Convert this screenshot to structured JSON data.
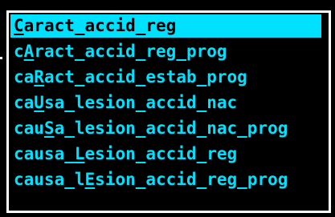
{
  "menu": {
    "selected_index": 0,
    "colors": {
      "text": "#00e0ff",
      "highlight_bg": "#00e0ff",
      "highlight_text": "#000000",
      "border": "#ffffff",
      "background": "#000000"
    },
    "items": [
      {
        "before": "",
        "hotkey": "C",
        "after": "aract_accid_reg"
      },
      {
        "before": "c",
        "hotkey": "A",
        "after": "ract_accid_reg_prog"
      },
      {
        "before": "ca",
        "hotkey": "R",
        "after": "act_accid_estab_prog"
      },
      {
        "before": "ca",
        "hotkey": "U",
        "after": "sa_lesion_accid_nac"
      },
      {
        "before": "cau",
        "hotkey": "S",
        "after": "a_lesion_accid_nac_prog"
      },
      {
        "before": "causa_",
        "hotkey": "L",
        "after": "esion_accid_reg"
      },
      {
        "before": "causa_l",
        "hotkey": "E",
        "after": "sion_accid_reg_prog"
      }
    ]
  }
}
